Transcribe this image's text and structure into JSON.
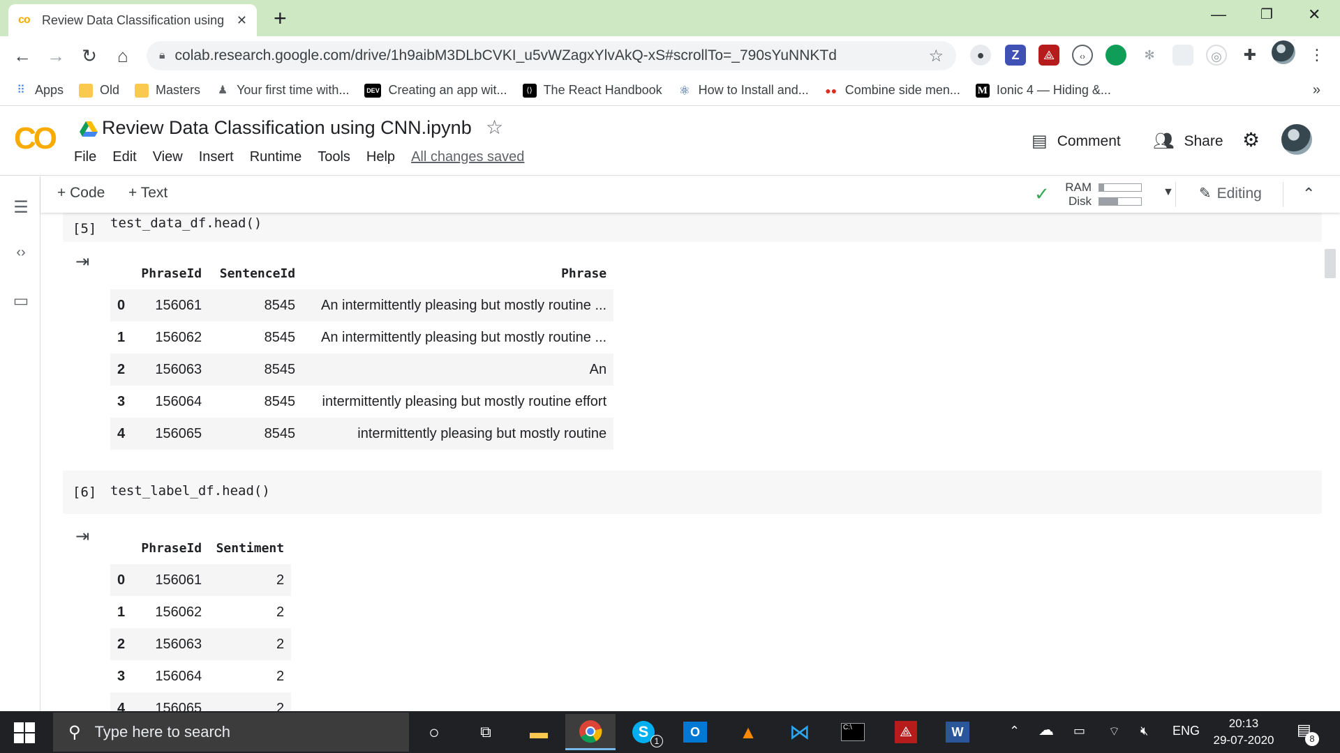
{
  "browser": {
    "tab_title": "Review Data Classification using CNN.ipynb",
    "tab_favicon": "co",
    "url": "colab.research.google.com/drive/1h9aibM3DLbCVKI_u5vWZagxYlvAkQ-xS#scrollTo=_790sYuNNKTd",
    "bookmarks": [
      {
        "label": "Apps",
        "icon": "apps-grid-icon",
        "color": "#4285f4"
      },
      {
        "label": "Old",
        "icon": "folder-icon",
        "color": "#f9ca4f"
      },
      {
        "label": "Masters",
        "icon": "folder-icon",
        "color": "#f9ca4f"
      },
      {
        "label": "Your first time with...",
        "icon": "person-icon",
        "color": "#5f6368"
      },
      {
        "label": "Creating an app wit...",
        "icon": "dev-icon",
        "color": "#000000"
      },
      {
        "label": "The React Handbook",
        "icon": "react-icon",
        "color": "#000000"
      },
      {
        "label": "How to Install and...",
        "icon": "electron-icon",
        "color": "#2b5797"
      },
      {
        "label": "Combine side men...",
        "icon": "dots-icon",
        "color": "#d93025"
      },
      {
        "label": "Ionic 4 — Hiding &...",
        "icon": "medium-icon",
        "color": "#000000"
      }
    ],
    "more_bookmarks": "»"
  },
  "colab": {
    "notebook_title": "Review Data Classification using CNN.ipynb",
    "menu": [
      "File",
      "Edit",
      "View",
      "Insert",
      "Runtime",
      "Tools",
      "Help"
    ],
    "save_status": "All changes saved",
    "comment_label": "Comment",
    "share_label": "Share",
    "toolbar": {
      "code_label": "+ Code",
      "text_label": "+ Text",
      "ram_label": "RAM",
      "disk_label": "Disk",
      "ram_usage": 0.12,
      "disk_usage": 0.45,
      "editing_label": "Editing"
    }
  },
  "cells": [
    {
      "exec_count": "[5]",
      "code": "test_data_df.head()",
      "output": {
        "columns": [
          "",
          "PhraseId",
          "SentenceId",
          "Phrase"
        ],
        "rows": [
          [
            "0",
            "156061",
            "8545",
            "An intermittently pleasing but mostly routine ..."
          ],
          [
            "1",
            "156062",
            "8545",
            "An intermittently pleasing but mostly routine ..."
          ],
          [
            "2",
            "156063",
            "8545",
            "An"
          ],
          [
            "3",
            "156064",
            "8545",
            "intermittently pleasing but mostly routine effort"
          ],
          [
            "4",
            "156065",
            "8545",
            "intermittently pleasing but mostly routine"
          ]
        ]
      }
    },
    {
      "exec_count": "[6]",
      "code": "test_label_df.head()",
      "output": {
        "columns": [
          "",
          "PhraseId",
          "Sentiment"
        ],
        "rows": [
          [
            "0",
            "156061",
            "2"
          ],
          [
            "1",
            "156062",
            "2"
          ],
          [
            "2",
            "156063",
            "2"
          ],
          [
            "3",
            "156064",
            "2"
          ],
          [
            "4",
            "156065",
            "2"
          ]
        ]
      }
    }
  ],
  "taskbar": {
    "search_placeholder": "Type here to search",
    "language": "ENG",
    "time": "20:13",
    "date": "29-07-2020",
    "notification_count": "8",
    "skype_badge": "1"
  }
}
